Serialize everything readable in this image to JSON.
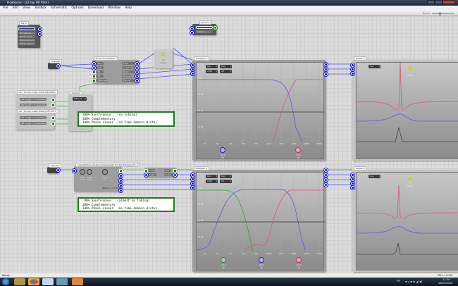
{
  "window": {
    "title": "FlowStone - [32-tap FIR filter]",
    "menu": [
      "File",
      "Edit",
      "View",
      "Toolbox",
      "Schematic",
      "Options",
      "Download",
      "Window",
      "Help"
    ],
    "zoom_label": "Zoom"
  },
  "ds_in": {
    "title": "DS In",
    "items": [
      "Prolific de sortie",
      "Microphone (...)",
      "Stereo mix (...)",
      "Micro Interne (...)",
      "Entree Ligne (...)"
    ]
  },
  "ds_out": {
    "title": "DS Out",
    "items": [
      "Haut-parleurs (...)",
      "Casque (...)"
    ]
  },
  "impulse": {
    "title": "Impulse"
  },
  "convolution": {
    "title": "Direct Convolution",
    "inputs": [
      "L in",
      "R in",
      "F1",
      "F2",
      "FIR length"
    ],
    "outputs": [
      "L out",
      "L conv out",
      "R out",
      "R conv out",
      "FIR out"
    ]
  },
  "delay": {
    "value": "15",
    "label": "Delay"
  },
  "fir_box1": {
    "title": "22 - 31-tap 2-way Xover (Moutlan)",
    "rows": [
      "IR1 length = 31 samples",
      "IR2 length = 31 samples"
    ]
  },
  "fir_box2": {
    "title": "22 - 31-tap 2-way Xover (DFT IDFT)",
    "rows": [
      "IR1 length = 31 samples",
      "IR2 length = 31 samples"
    ]
  },
  "selector": {
    "title": "Selector",
    "value": "Filter 01"
  },
  "text1": [
    "100% Synchronous   (no lobing)",
    "100% Complementary",
    "100% Phase Linear  (no time domain distо)"
  ],
  "text2": [
    " 90% Synchronous   (almost no lobing)",
    "100% Complementary",
    "100% Phase Linear  (no time domain disto)"
  ],
  "linkwitz": {
    "title": "Linkwitz-Riley Delay Compensated Double Butterworth",
    "knobs": [
      {
        "value": "375",
        "unit": "Fc Hz"
      },
      {
        "value": "2000",
        "unit": "Fc Hz"
      },
      {
        "value": "0.47",
        "unit": "k"
      }
    ],
    "latency": "latency = 2.9 ms"
  },
  "mixer2": {
    "rows": [
      "L out",
      "R out"
    ],
    "right": [
      "Out",
      "R out"
    ]
  },
  "analyser1": {
    "title": "Analyser 1",
    "dropdowns": [
      "Run",
      "Mag",
      "2048",
      "dB"
    ],
    "yticks": [
      "0 dB",
      "-10 dB",
      "-20 dB",
      "-30 dB"
    ],
    "xticks": [
      "10",
      "50",
      "100",
      "200",
      "500",
      "1000",
      "2000",
      "5000",
      "10000",
      "20000"
    ],
    "knobs": [
      {
        "value": "-20.0",
        "unit": "dB",
        "color": "#1a1ae0"
      },
      {
        "value": "-20.0",
        "unit": "dB",
        "color": "#e0207a"
      }
    ]
  },
  "analyser2": {
    "title": "Analyser 2",
    "dropdowns": [
      "Run",
      "Mag",
      "2048",
      "dB"
    ],
    "yticks": [
      "0 dB",
      "-10 dB",
      "-20 dB",
      "-30 dB"
    ],
    "xticks": [
      "10",
      "50",
      "100",
      "200",
      "500",
      "1000",
      "2000",
      "5000",
      "10000",
      "20000"
    ],
    "knobs": [
      {
        "value": "-20.0",
        "unit": "dB",
        "color": "#1a9a1a"
      },
      {
        "value": "-20.0",
        "unit": "dB",
        "color": "#1a1ae0"
      },
      {
        "value": "-20.0",
        "unit": "dB",
        "color": "#e0207a"
      }
    ]
  },
  "scope1": {
    "title": "Scope 1",
    "dropdown": "Run",
    "knob": {
      "value": "0",
      "label": "Delay"
    }
  },
  "scope2": {
    "title": "Scope 2",
    "dropdown": "Run",
    "knob": {
      "value": "0",
      "label": "Delay"
    }
  },
  "status": {
    "left": "Ready",
    "right": "CPU = 0.2%"
  },
  "taskbar": {
    "lang": "FR",
    "time": "11:34",
    "date": "16/01/2020",
    "apps": [
      "start",
      "explorer",
      "chrome",
      "window",
      "app",
      "flowstone"
    ]
  }
}
